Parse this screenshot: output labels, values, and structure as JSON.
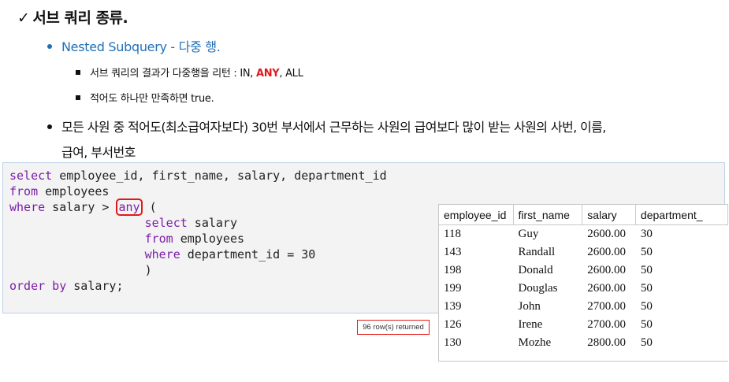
{
  "heading": {
    "check": "✓",
    "text": "서브 쿼리 종류."
  },
  "bullet1": {
    "text": "Nested Subquery - 다중 행."
  },
  "sub1": {
    "before": "서브 쿼리의 결과가 다중행을 리턴 : IN, ",
    "keyword": "ANY",
    "after": ", ALL"
  },
  "sub2": {
    "text": "적어도 하나만 만족하면 true."
  },
  "bullet2": {
    "line1": "모든 사원 중 적어도(최소급여자보다) 30번 부서에서 근무하는 사원의 급여보다 많이 받는 사원의 사번, 이름,",
    "line2": "급여, 부서번호"
  },
  "sql": {
    "line1_kw": "select",
    "line1_rest": " employee_id, first_name, salary, department_id",
    "line2_kw": "from",
    "line2_rest": " employees",
    "line3_kw": "where",
    "line3_mid": " salary > ",
    "line3_any": "any",
    "line3_end": " (",
    "line4_kw": "select",
    "line4_rest": " salary",
    "line5_kw": "from",
    "line5_rest": " employees",
    "line6_kw": "where",
    "line6_rest": " department_id = 30",
    "line7": ")",
    "line8_kw": "order by",
    "line8_rest": " salary;"
  },
  "rows_returned": "96 row(s) returned",
  "result": {
    "columns": [
      "employee_id",
      "first_name",
      "salary",
      "department_"
    ],
    "rows": [
      [
        "118",
        "Guy",
        "2600.00",
        "30"
      ],
      [
        "143",
        "Randall",
        "2600.00",
        "50"
      ],
      [
        "198",
        "Donald",
        "2600.00",
        "50"
      ],
      [
        "199",
        "Douglas",
        "2600.00",
        "50"
      ],
      [
        "139",
        "John",
        "2700.00",
        "50"
      ],
      [
        "126",
        "Irene",
        "2700.00",
        "50"
      ],
      [
        "130",
        "Mozhe",
        "2800.00",
        "50"
      ]
    ]
  },
  "colors": {
    "blue": "#1f6fb8",
    "red": "#e01a1a",
    "keyword": "#7b1ea6"
  }
}
